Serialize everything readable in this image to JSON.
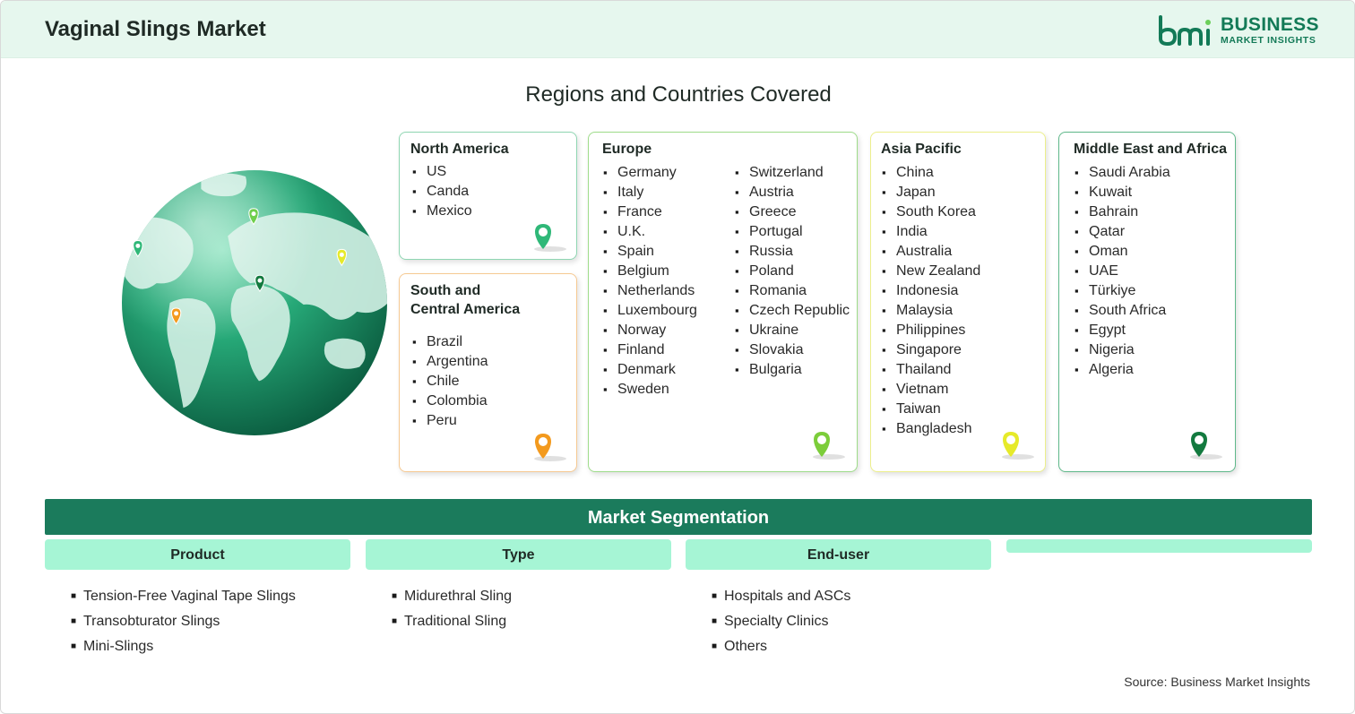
{
  "header": {
    "title": "Vaginal Slings Market",
    "logo_line1": "BUSINESS",
    "logo_line2": "MARKET INSIGHTS",
    "logo_mark": "bmi"
  },
  "regions_title": "Regions and Countries Covered",
  "regions": [
    {
      "name": "North America",
      "color": "#8fd6b2",
      "pin_color": "#2fb878",
      "columns": [
        [
          "US",
          "Canda",
          "Mexico"
        ]
      ]
    },
    {
      "name": "South and Central America",
      "name_lines": [
        "South and",
        "Central America"
      ],
      "color": "#f6c992",
      "pin_color": "#f39a1e",
      "columns": [
        [
          "Brazil",
          "Argentina",
          "Chile",
          "Colombia",
          "Peru"
        ]
      ]
    },
    {
      "name": "Europe",
      "color": "#9edc8a",
      "pin_color": "#7ccd3a",
      "columns": [
        [
          "Germany",
          "Italy",
          "France",
          "U.K.",
          "Spain",
          "Belgium",
          "Netherlands",
          "Luxembourg",
          "Norway",
          "Finland",
          "Denmark",
          "Sweden"
        ],
        [
          "Switzerland",
          "Austria",
          "Greece",
          "Portugal",
          "Russia",
          "Poland",
          "Romania",
          "Czech Republic",
          "Ukraine",
          "Slovakia",
          "Bulgaria"
        ]
      ]
    },
    {
      "name": "Asia Pacific",
      "color": "#ecef8c",
      "pin_color": "#e6ea2a",
      "columns": [
        [
          "China",
          "Japan",
          "South Korea",
          "India",
          "Australia",
          "New Zealand",
          "Indonesia",
          "Malaysia",
          "Philippines",
          "Singapore",
          "Thailand",
          "Vietnam",
          "Taiwan",
          "Bangladesh"
        ]
      ]
    },
    {
      "name": "Middle East and Africa",
      "color": "#5fb88a",
      "pin_color": "#137a3f",
      "columns": [
        [
          "Saudi Arabia",
          "Kuwait",
          "Bahrain",
          "Qatar",
          "Oman",
          "UAE",
          "Türkiye",
          "South Africa",
          "Egypt",
          "Nigeria",
          "Algeria"
        ]
      ]
    }
  ],
  "segmentation": {
    "title": "Market Segmentation",
    "columns": [
      {
        "heading": "Product",
        "items": [
          "Tension-Free Vaginal Tape Slings",
          "Transobturator Slings",
          "Mini-Slings"
        ]
      },
      {
        "heading": "Type",
        "items": [
          "Midurethral Sling",
          "Traditional Sling"
        ]
      },
      {
        "heading": "End-user",
        "items": [
          "Hospitals and ASCs",
          "Specialty Clinics",
          "Others"
        ]
      },
      {
        "heading": "",
        "items": []
      }
    ]
  },
  "source": "Source: Business Market Insights",
  "colors": {
    "header_bg": "#e6f7ee",
    "brand_green": "#137a57",
    "segmentation_bar": "#1b7b5c",
    "segment_header": "#a6f5d5"
  },
  "icons": [
    "globe-icon",
    "map-pin-icon",
    "bmi-logo-icon"
  ]
}
